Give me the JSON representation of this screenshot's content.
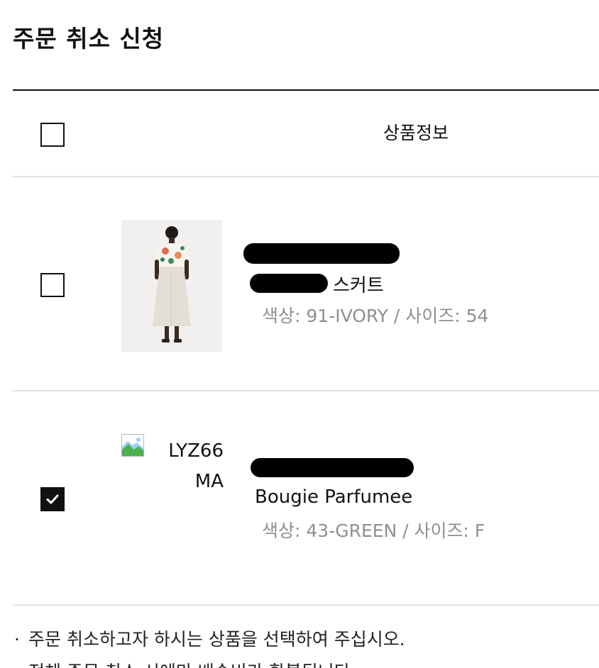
{
  "page_title": "주문 취소 신청",
  "table_header": {
    "product_info": "상품정보"
  },
  "items": [
    {
      "checked": false,
      "name_suffix": "스커트",
      "option": "색상: 91-IVORY / 사이즈: 54"
    },
    {
      "checked": true,
      "image_alt": "LYZ66 MA",
      "name": "Bougie Parfumee",
      "option": "색상: 43-GREEN / 사이즈: F"
    }
  ],
  "notices": [
    "주문 취소하고자 하시는 상품을 선택하여 주십시오.",
    "전체 주문 취소 시에만 배송비가 환불됩니다."
  ],
  "colors": {
    "text": "#111111",
    "muted": "#8f8f8f",
    "divider": "#e2e2e2"
  }
}
